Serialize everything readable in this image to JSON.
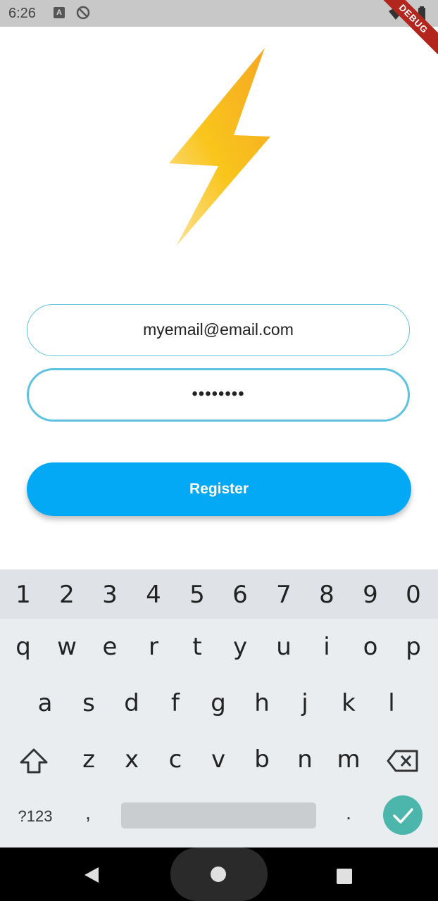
{
  "status_bar": {
    "time": "6:26",
    "a_icon": "A",
    "debug_label": "DEBUG"
  },
  "logo": {
    "icon": "lightning-bolt-icon",
    "colors": [
      "#f5a623",
      "#f9c51c",
      "#fde4a0"
    ]
  },
  "form": {
    "email_value": "myemail@email.com",
    "password_value": "••••••••",
    "register_label": "Register"
  },
  "keyboard": {
    "numbers": [
      "1",
      "2",
      "3",
      "4",
      "5",
      "6",
      "7",
      "8",
      "9",
      "0"
    ],
    "row1": [
      "q",
      "w",
      "e",
      "r",
      "t",
      "y",
      "u",
      "i",
      "o",
      "p"
    ],
    "row2": [
      "a",
      "s",
      "d",
      "f",
      "g",
      "h",
      "j",
      "k",
      "l"
    ],
    "row3": [
      "z",
      "x",
      "c",
      "v",
      "b",
      "n",
      "m"
    ],
    "symbols_label": "?123",
    "comma": ",",
    "period": "."
  },
  "colors": {
    "accent": "#03a9f4",
    "field_border": "#5fc3e0",
    "done_key": "#4db6ac"
  }
}
